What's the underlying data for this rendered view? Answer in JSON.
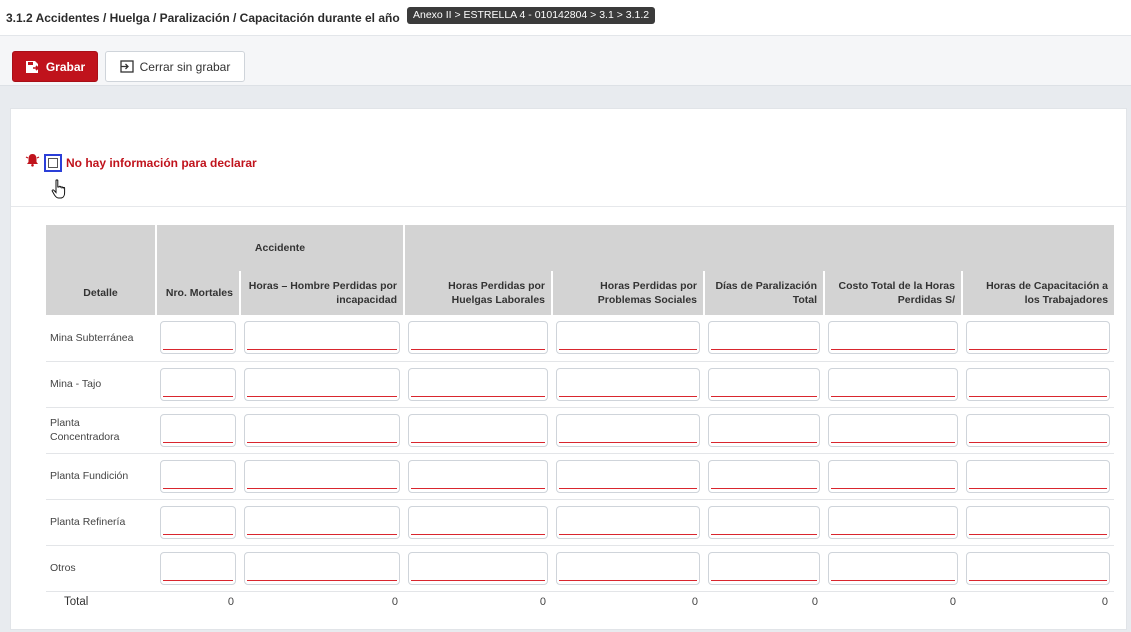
{
  "header": {
    "title": "3.1.2 Accidentes / Huelga / Paralización / Capacitación durante el año",
    "breadcrumb": "Anexo II > ESTRELLA 4 - 010142804 > 3.1 > 3.1.2"
  },
  "toolbar": {
    "save_label": "Grabar",
    "close_label": "Cerrar sin grabar"
  },
  "no_data": {
    "label": "No hay información para declarar",
    "checked": false
  },
  "table": {
    "group_header": "Accidente",
    "columns": [
      "Detalle",
      "Nro. Mortales",
      "Horas – Hombre Perdidas por incapacidad",
      "Horas Perdidas por Huelgas Laborales",
      "Horas Perdidas por Problemas Sociales",
      "Días de Paralización Total",
      "Costo Total de la Horas Perdidas S/",
      "Horas de Capacitación a los Trabajadores"
    ],
    "rows": [
      "Mina Subterránea",
      "Mina - Tajo",
      "Planta Concentradora",
      "Planta Fundición",
      "Planta Refinería",
      "Otros"
    ],
    "total_label": "Total",
    "totals": [
      "0",
      "0",
      "0",
      "0",
      "0",
      "0",
      "0"
    ]
  },
  "colors": {
    "primary_red": "#c0131c",
    "header_gray": "#d3d3d3",
    "checkbox_focus": "#2b3fd8"
  },
  "icons": {
    "save": "save-icon",
    "close": "exit-icon",
    "alert": "alarm-bell-icon",
    "cursor": "hand-pointer-icon"
  }
}
